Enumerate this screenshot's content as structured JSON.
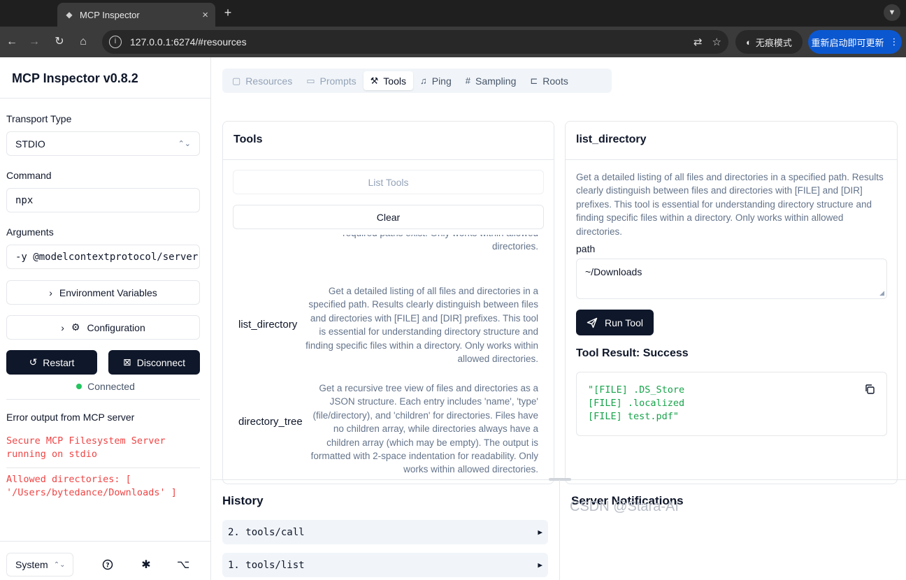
{
  "browser": {
    "tab_title": "MCP Inspector",
    "tab_close": "×",
    "new_tab": "+",
    "url": "127.0.0.1:6274/#resources",
    "incognito_label": "无痕模式",
    "update_label": "重新启动即可更新"
  },
  "sidebar": {
    "app_title": "MCP Inspector v0.8.2",
    "transport_label": "Transport Type",
    "transport_value": "STDIO",
    "command_label": "Command",
    "command_value": "npx",
    "arguments_label": "Arguments",
    "arguments_value": "-y @modelcontextprotocol/server-filesystem",
    "env_button": "Environment Variables",
    "config_button": "Configuration",
    "restart_button": "Restart",
    "disconnect_button": "Disconnect",
    "status": "Connected",
    "error_title": "Error output from MCP server",
    "error_lines": [
      "Secure MCP Filesystem Server running on stdio",
      "Allowed directories: [ '/Users/bytedance/Downloads' ]"
    ],
    "theme_value": "System"
  },
  "tabs": [
    {
      "label": "Resources",
      "icon": "file-icon",
      "state": "disabled"
    },
    {
      "label": "Prompts",
      "icon": "message-icon",
      "state": "disabled"
    },
    {
      "label": "Tools",
      "icon": "hammer-icon",
      "state": "active"
    },
    {
      "label": "Ping",
      "icon": "bell-icon",
      "state": "enabled"
    },
    {
      "label": "Sampling",
      "icon": "hash-icon",
      "state": "enabled"
    },
    {
      "label": "Roots",
      "icon": "folder-tree-icon",
      "state": "enabled"
    }
  ],
  "tools_panel": {
    "title": "Tools",
    "list_button": "List Tools",
    "clear_button": "Clear",
    "items": [
      {
        "name": "",
        "description": "required paths exist. Only works within allowed directories."
      },
      {
        "name": "list_directory",
        "description": "Get a detailed listing of all files and directories in a specified path. Results clearly distinguish between files and directories with [FILE] and [DIR] prefixes. This tool is essential for understanding directory structure and finding specific files within a directory. Only works within allowed directories."
      },
      {
        "name": "directory_tree",
        "description": "Get a recursive tree view of files and directories as a JSON structure. Each entry includes 'name', 'type' (file/directory), and 'children' for directories. Files have no children array, while directories always have a children array (which may be empty). The output is formatted with 2-space indentation for readability. Only works within allowed directories."
      }
    ]
  },
  "detail_panel": {
    "title": "list_directory",
    "description": "Get a detailed listing of all files and directories in a specified path. Results clearly distinguish between files and directories with [FILE] and [DIR] prefixes. This tool is essential for understanding directory structure and finding specific files within a directory. Only works within allowed directories.",
    "path_label": "path",
    "path_value": "~/Downloads",
    "run_button": "Run Tool",
    "result_title": "Tool Result: Success",
    "result_lines": [
      "\"[FILE] .DS_Store",
      "[FILE] .localized",
      "[FILE] test.pdf\""
    ]
  },
  "history": {
    "title": "History",
    "items": [
      "2. tools/call",
      "1. tools/list"
    ]
  },
  "notifications": {
    "title": "Server Notifications"
  },
  "watermark": "CSDN @Stara-AI",
  "colors": {
    "accent_dark": "#0f172a",
    "error": "#ef4444",
    "success": "#16a34a",
    "connected": "#22c55e",
    "update_blue": "#0b57d0"
  }
}
